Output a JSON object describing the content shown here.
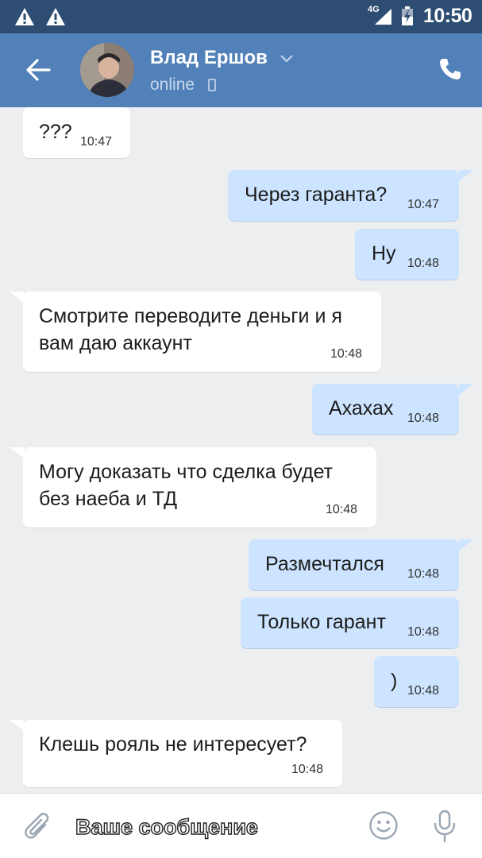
{
  "status_bar": {
    "network": "4G",
    "time": "10:50",
    "left_icons": [
      "warning-icon",
      "warning-icon"
    ]
  },
  "header": {
    "name": "Влад Ершов",
    "status": "online",
    "accent_color": "#5181b8",
    "statusbar_color": "#2d4d73"
  },
  "messages": [
    {
      "dir": "in",
      "text": "???",
      "time": "10:47"
    },
    {
      "dir": "out",
      "text": "Через гаранта?",
      "time": "10:47"
    },
    {
      "dir": "out",
      "text": "Ну",
      "time": "10:48"
    },
    {
      "dir": "in",
      "text": "Смотрите переводите деньги и я\nвам даю аккаунт",
      "time": "10:48"
    },
    {
      "dir": "out",
      "text": "Ахахах",
      "time": "10:48"
    },
    {
      "dir": "in",
      "text": "Могу доказать что сделка будет\nбез наеба и ТД",
      "time": "10:48"
    },
    {
      "dir": "out",
      "text": "Размечтался",
      "time": "10:48"
    },
    {
      "dir": "out",
      "text": "Только гарант",
      "time": "10:48"
    },
    {
      "dir": "out",
      "text": ")",
      "time": "10:48"
    },
    {
      "dir": "in",
      "text": "Клешь рояль не интересует?",
      "time": "10:48"
    }
  ],
  "composer": {
    "placeholder": "Ваше сообщение"
  },
  "colors": {
    "incoming_bubble": "#ffffff",
    "outgoing_bubble": "#cce4ff",
    "background": "#edeef0"
  }
}
